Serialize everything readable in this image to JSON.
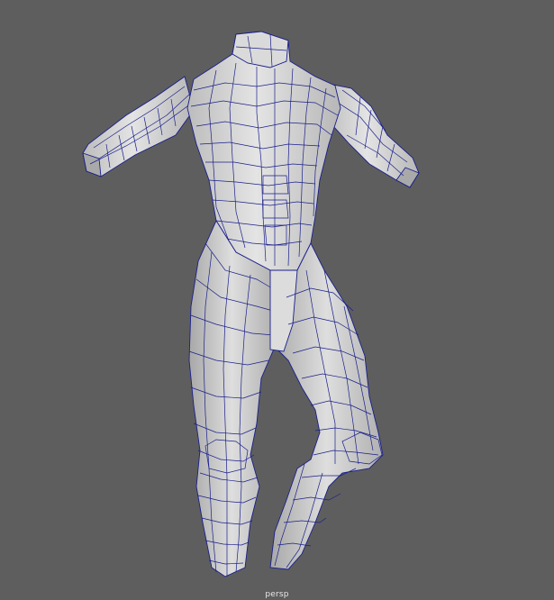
{
  "viewport": {
    "camera_name": "persp",
    "background_color": "#5e5e5e",
    "wire_color": "#1a1f8a",
    "surface_color": "#d6d6d6",
    "shadow_color": "#a9a9a9"
  },
  "scene": {
    "object": "muscular-torso-legs-mesh",
    "display_mode": "wireframe-on-shaded"
  }
}
